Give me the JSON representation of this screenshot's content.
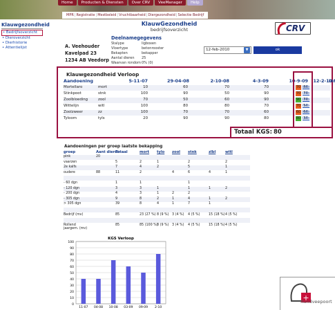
{
  "topnav": [
    "Home",
    "Producten & Diensten",
    "Over CRV",
    "VeeManager",
    "Help"
  ],
  "subnav": [
    "MPR",
    "Registratie",
    "Mestbeleid",
    "Vruchtbaarheid",
    "Diergezondheid",
    "Selectie Bedrijf"
  ],
  "leftnav": {
    "title": "Klauwgezondheid",
    "items": [
      "Bedrijfsoverzicht",
      "Dieroverzicht",
      "Dierhistorie",
      "Attentielijst"
    ]
  },
  "page": {
    "title": "KlauwGezondheid",
    "subtitle": "bedrijfsoverzicht"
  },
  "logo": {
    "text": "CRV"
  },
  "client": {
    "name": "A. Veehouder",
    "street": "Kavelpad 23",
    "city": "1234 AB Veedorp"
  },
  "deelname": {
    "title": "Deelnamegegevens",
    "rows": [
      [
        "Stalype",
        "ligboxen"
      ],
      [
        "Vloertype",
        "betonrooster"
      ],
      [
        "Bekapten",
        "bekapper"
      ],
      [
        "Aantal dieren",
        "25"
      ],
      [
        "Waarvan rondom",
        "0% (0)"
      ]
    ]
  },
  "date": {
    "value": "12-feb-2010",
    "ok": "ok"
  },
  "verloop": {
    "title": "Klauwgezondheid Verloop",
    "headers": [
      "Aandoening",
      "5-11-07",
      "29-04-08",
      "2-10-08",
      "4-3-09",
      "10-9-09",
      "12-2-10",
      "Info"
    ],
    "rows": [
      {
        "name": "Mortellaro",
        "code": "mort",
        "v": [
          "10",
          "60",
          "70",
          "70",
          "80",
          "70"
        ],
        "color": "#e86020",
        "info": "info"
      },
      {
        "name": "Stinkpoot",
        "code": "stnk",
        "v": [
          "100",
          "90",
          "50",
          "90",
          "70",
          "70"
        ],
        "color": "#e86020",
        "info": "info"
      },
      {
        "name": "Zoolbloeding",
        "code": "zool",
        "v": [
          "70",
          "50",
          "60",
          "90",
          "70",
          "90"
        ],
        "color": "#44b030",
        "info": "info"
      },
      {
        "name": "Wittelijn",
        "code": "witl",
        "v": [
          "100",
          "80",
          "80",
          "70",
          "50",
          "70"
        ],
        "color": "#e86020",
        "info": "info"
      },
      {
        "name": "Zoolzweer",
        "code": "zz",
        "v": [
          "100",
          "70",
          "70",
          "60",
          "60",
          "60"
        ],
        "color": "#e86020",
        "info": "info"
      },
      {
        "name": "Tyloom",
        "code": "tyls",
        "v": [
          "20",
          "90",
          "90",
          "80",
          "30",
          "80"
        ],
        "color": "#44b030",
        "info": "info"
      }
    ],
    "totaal_label": "Totaal KGS:",
    "totaal_value": "80"
  },
  "aandoeningen": {
    "title": "Aandoeningen per groep laatste bekapping",
    "headers": [
      "groep",
      "Aant dieren",
      "Totaal",
      "mort",
      "tylo",
      "zool",
      "stnk",
      "zlbl",
      "witl"
    ],
    "rows": [
      [
        "pink",
        "20",
        "",
        "",
        "",
        "",
        "",
        "",
        ""
      ],
      [
        "vaarzen",
        "",
        "5",
        "2",
        "1",
        "",
        "2",
        "",
        "2"
      ],
      [
        "2e kalfs",
        "",
        "7",
        "4",
        "2",
        "",
        "5",
        "",
        "1"
      ],
      [
        "oudere",
        "88",
        "11",
        "2",
        "",
        "4",
        "6",
        "4",
        "1"
      ],
      [
        "",
        "",
        "",
        "",
        "",
        "",
        "",
        "",
        ""
      ],
      [
        "- 60 dgn",
        "",
        "1",
        "1",
        "",
        "",
        "1",
        "",
        ""
      ],
      [
        "- 120 dgn",
        "",
        "3",
        "3",
        "1",
        "",
        "1",
        "1",
        "2"
      ],
      [
        "- 200 dgn",
        "",
        "4",
        "3",
        "1",
        "2",
        "2",
        "",
        ""
      ],
      [
        "- 305 dgn",
        "",
        "9",
        "8",
        "2",
        "1",
        "4",
        "1",
        "2"
      ],
      [
        "> 305 dgn",
        "",
        "39",
        "8",
        "4",
        "1",
        "7",
        "1",
        ""
      ],
      [
        "",
        "",
        "",
        "",
        "",
        "",
        "",
        "",
        ""
      ],
      [
        "Bedrijf (mv)",
        "",
        "85",
        "23 (27 %)",
        "8 (9 %)",
        "3 (4 %)",
        "4 (5 %)",
        "15 (18 %)",
        "4 (5 %)"
      ],
      [
        "",
        "",
        "",
        "",
        "",
        "",
        "",
        "",
        ""
      ],
      [
        "Rollend jaargem. (mv)",
        "",
        "85",
        "85 (100 %)",
        "8 (9 %)",
        "3 (4 %)",
        "4 (5 %)",
        "15 (18 %)",
        "4 (5 %)"
      ]
    ]
  },
  "chart_data": {
    "type": "bar",
    "title": "KGS Verloop",
    "categories": [
      "11-07",
      "04-08",
      "10-08",
      "03-09",
      "09-09",
      "2-10"
    ],
    "values": [
      40,
      40,
      70,
      60,
      50,
      80
    ],
    "ylim": [
      0,
      100
    ],
    "yticks": [
      0,
      10,
      20,
      30,
      40,
      50,
      60,
      70,
      80,
      90,
      100
    ],
    "bar_color": "#5a5adc",
    "grid": true
  },
  "footer_logo": {
    "text": "Rundveepoort"
  }
}
